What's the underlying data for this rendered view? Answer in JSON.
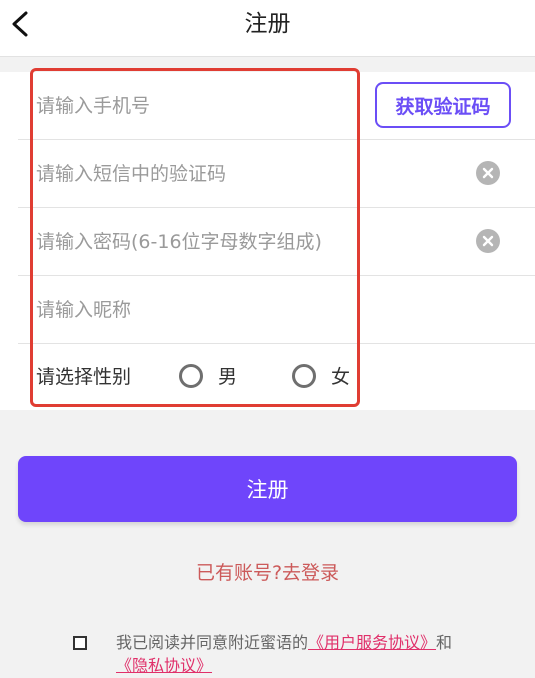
{
  "header": {
    "title": "注册",
    "back_icon": "chevron-left-icon"
  },
  "form": {
    "phone_placeholder": "请输入手机号",
    "get_code_label": "获取验证码",
    "sms_code_placeholder": "请输入短信中的验证码",
    "password_placeholder": "请输入密码(6-16位字母数字组成)",
    "nickname_placeholder": "请输入昵称",
    "gender_label": "请选择性别",
    "gender_options": [
      "男",
      "女"
    ],
    "clear_icon": "clear-circle-icon"
  },
  "register_button": "注册",
  "login_link": "已有账号?去登录",
  "agreement": {
    "prefix": "我已阅读并同意附近蜜语的",
    "user_service": "《用户服务协议》",
    "and": "和",
    "privacy": "《隐私协议》"
  },
  "colors": {
    "accent": "#6f45fb",
    "highlight_border": "#e03d33",
    "login_link": "#cc5a5a",
    "agreement_link": "#e0306a"
  }
}
